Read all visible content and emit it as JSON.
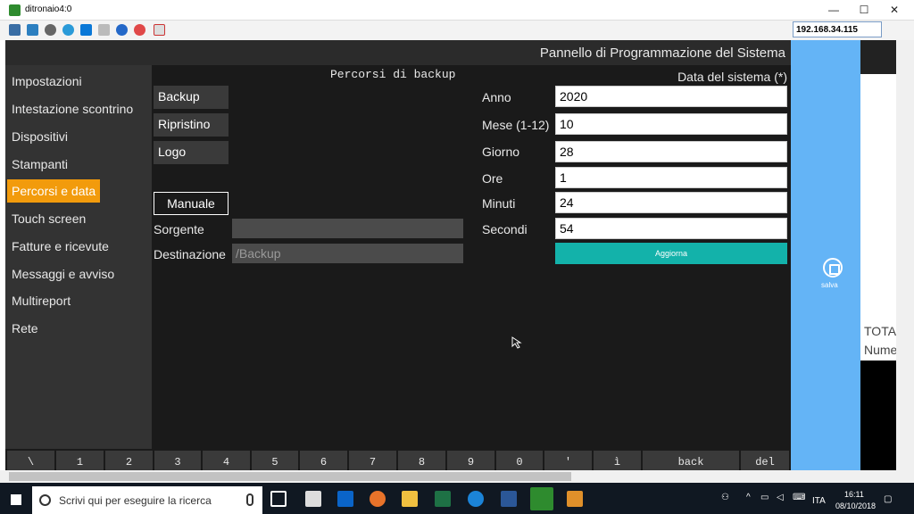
{
  "window": {
    "title": "ditronaio4:0"
  },
  "toolbar": {
    "ip": "192.168.34.115"
  },
  "header": {
    "title": "Pannello di Programmazione del Sistema"
  },
  "sidebar": {
    "items": [
      {
        "label": "Impostazioni"
      },
      {
        "label": "Intestazione scontrino"
      },
      {
        "label": "Dispositivi"
      },
      {
        "label": "Stampanti"
      },
      {
        "label": "Percorsi e data",
        "active": true
      },
      {
        "label": "Touch screen"
      },
      {
        "label": "Fatture e ricevute"
      },
      {
        "label": "Messaggi e avviso"
      },
      {
        "label": "Multireport"
      },
      {
        "label": "Rete"
      }
    ]
  },
  "paths": {
    "heading": "Percorsi di backup",
    "backup_label": "Backup",
    "restore_label": "Ripristino",
    "logo_label": "Logo",
    "manual_label": "Manuale",
    "source_label": "Sorgente",
    "source_value": "",
    "destination_label": "Destinazione",
    "destination_value": "/Backup"
  },
  "system_date": {
    "heading": "Data del sistema (*)",
    "year_label": "Anno",
    "year_value": "2020",
    "month_label": "Mese (1-12)",
    "month_value": "10",
    "day_label": "Giorno",
    "day_value": "28",
    "hour_label": "Ore",
    "hour_value": "1",
    "minute_label": "Minuti",
    "minute_value": "24",
    "second_label": "Secondi",
    "second_value": "54",
    "update_label": "Aggiorna"
  },
  "keyboard": {
    "keys": [
      "\\",
      "1",
      "2",
      "3",
      "4",
      "5",
      "6",
      "7",
      "8",
      "9",
      "0",
      "'",
      "ì",
      "back",
      "del"
    ]
  },
  "right_panel": {
    "save_label": "salva",
    "icon": "save-icon"
  },
  "far_panel": {
    "total_label": "TOTA",
    "number_label": "Nume"
  },
  "taskbar": {
    "search_placeholder": "Scrivi qui per eseguire la ricerca",
    "language": "ITA",
    "time": "16:11",
    "date": "08/10/2018"
  },
  "colors": {
    "accent": "#f29b0c",
    "update": "#13b2aa",
    "right_panel": "#64b4f6",
    "app_bg": "#1a1a1a",
    "sidebar_bg": "#333333"
  }
}
